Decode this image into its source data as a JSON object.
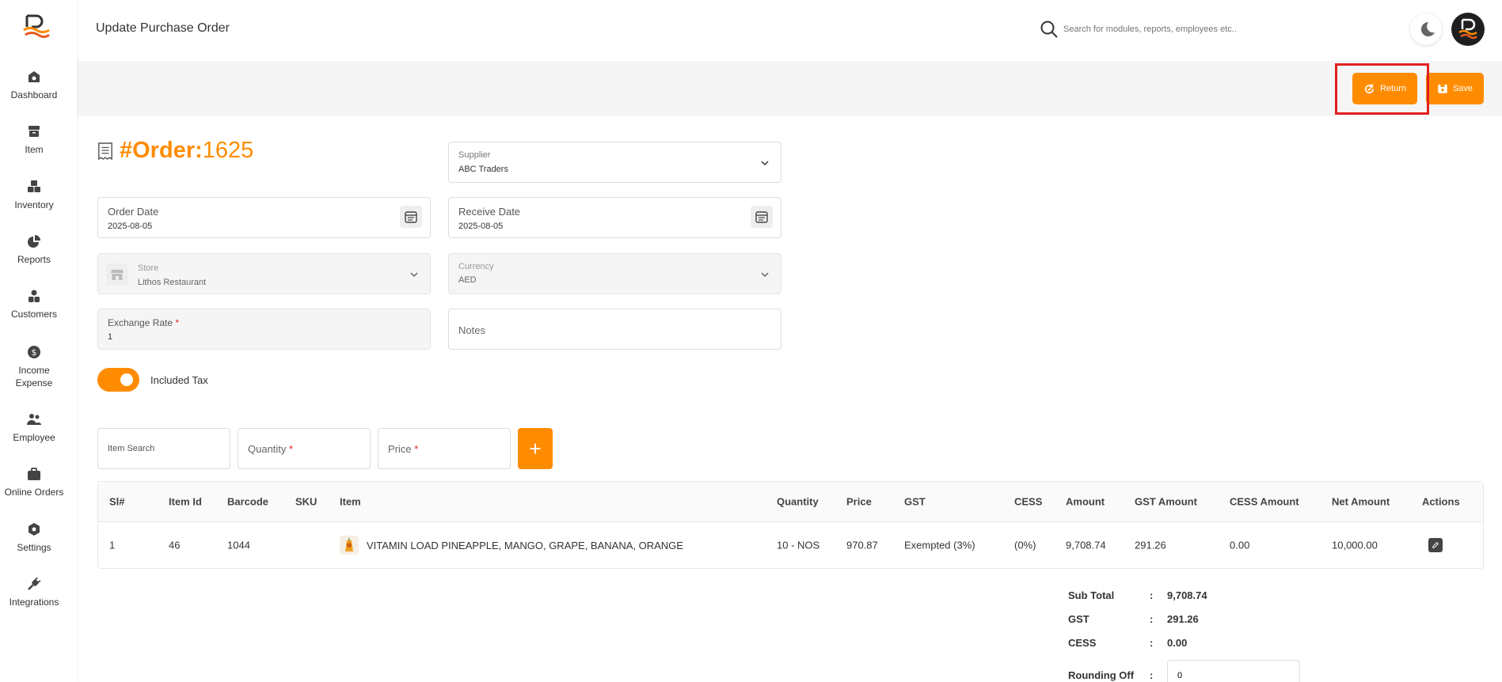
{
  "header": {
    "title": "Update Purchase Order",
    "search_placeholder": "Search for modules, reports, employees etc.."
  },
  "sidebar": {
    "items": [
      {
        "label": "Dashboard",
        "icon": "dashboard-icon"
      },
      {
        "label": "Item",
        "icon": "item-icon"
      },
      {
        "label": "Inventory",
        "icon": "inventory-icon"
      },
      {
        "label": "Reports",
        "icon": "reports-icon"
      },
      {
        "label": "Customers",
        "icon": "customers-icon"
      },
      {
        "label": "Income\nExpense",
        "icon": "income-expense-icon"
      },
      {
        "label": "Employee",
        "icon": "employee-icon"
      },
      {
        "label": "Online Orders",
        "icon": "online-orders-icon"
      },
      {
        "label": "Settings",
        "icon": "settings-icon"
      },
      {
        "label": "Integrations",
        "icon": "integrations-icon"
      }
    ]
  },
  "toolbar": {
    "return_label": "Return",
    "save_label": "Save"
  },
  "order": {
    "prefix": "#Order:",
    "number": "1625"
  },
  "form": {
    "supplier_label": "Supplier",
    "supplier_value": "ABC Traders",
    "order_date_label": "Order Date",
    "order_date_value": "2025-08-05",
    "receive_date_label": "Receive Date",
    "receive_date_value": "2025-08-05",
    "store_label": "Store",
    "store_value": "Lithos Restaurant",
    "currency_label": "Currency",
    "currency_value": "AED",
    "exchange_rate_label": "Exchange Rate",
    "exchange_rate_value": "1",
    "notes_placeholder": "Notes",
    "included_tax_label": "Included Tax",
    "included_tax_on": true
  },
  "item_entry": {
    "item_search_placeholder": "Item Search",
    "quantity_label": "Quantity",
    "price_label": "Price",
    "required_mark": "*",
    "add_label": "+"
  },
  "table": {
    "columns": [
      "Sl#",
      "Item Id",
      "Barcode",
      "SKU",
      "Item",
      "Quantity",
      "Price",
      "GST",
      "CESS",
      "Amount",
      "GST Amount",
      "CESS Amount",
      "Net Amount",
      "Actions"
    ],
    "rows": [
      {
        "sl": "1",
        "item_id": "46",
        "barcode": "1044",
        "sku": "",
        "item": "VITAMIN LOAD PINEAPPLE, MANGO, GRAPE, BANANA, ORANGE",
        "quantity": "10 - NOS",
        "price": "970.87",
        "gst": "Exempted (3%)",
        "cess": "(0%)",
        "amount": "9,708.74",
        "gst_amount": "291.26",
        "cess_amount": "0.00",
        "net_amount": "10,000.00"
      }
    ]
  },
  "summary": {
    "sub_total_label": "Sub Total",
    "sub_total_value": "9,708.74",
    "gst_label": "GST",
    "gst_value": "291.26",
    "cess_label": "CESS",
    "cess_value": "0.00",
    "rounding_label": "Rounding Off",
    "rounding_value": "0",
    "colon": ":"
  },
  "colors": {
    "accent": "#ff8c00",
    "highlight": "#e02020"
  }
}
